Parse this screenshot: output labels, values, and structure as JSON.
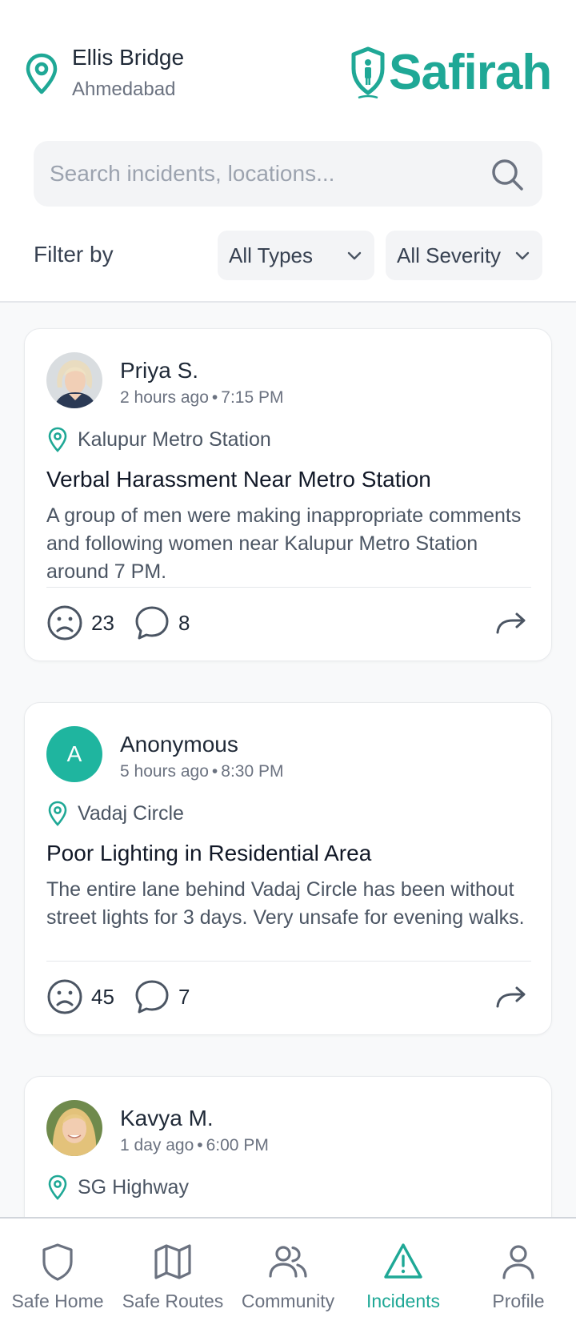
{
  "location": {
    "name": "Ellis Bridge",
    "city": "Ahmedabad"
  },
  "brand": {
    "name": "Safirah",
    "color": "#1fa896"
  },
  "search": {
    "placeholder": "Search incidents, locations..."
  },
  "filters": {
    "label": "Filter by",
    "type": "All Types",
    "severity": "All Severity"
  },
  "incidents": [
    {
      "author": "Priya S.",
      "time_ago": "2 hours ago",
      "time": "7:15 PM",
      "location": "Kalupur Metro Station",
      "title": "Verbal Harassment Near Metro Station",
      "description": "A group of men were making inappropriate comments and following women near Kalupur Metro Station around 7 PM.",
      "reactions": "23",
      "comments": "8"
    },
    {
      "author": "Anonymous",
      "avatar_letter": "A",
      "time_ago": "5 hours ago",
      "time": "8:30 PM",
      "location": "Vadaj Circle",
      "title": "Poor Lighting in Residential Area",
      "description": "The entire lane behind Vadaj Circle has been without street lights for 3 days. Very unsafe for evening walks.",
      "reactions": "45",
      "comments": "7"
    },
    {
      "author": "Kavya M.",
      "time_ago": "1 day ago",
      "time": "6:00 PM",
      "location": "SG Highway"
    }
  ],
  "nav": {
    "items": [
      {
        "label": "Safe Home",
        "icon": "shield-icon"
      },
      {
        "label": "Safe Routes",
        "icon": "map-icon"
      },
      {
        "label": "Community",
        "icon": "users-icon"
      },
      {
        "label": "Incidents",
        "icon": "alert-triangle-icon",
        "active": true
      },
      {
        "label": "Profile",
        "icon": "user-icon"
      }
    ]
  },
  "colors": {
    "accent": "#1fa896",
    "avatar_anon": "#1fb59f",
    "muted": "#6b7280"
  }
}
